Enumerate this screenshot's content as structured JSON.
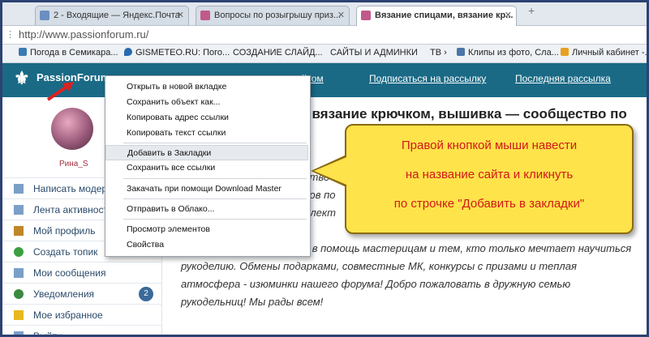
{
  "tabs": [
    {
      "title": "2 - Входящие — Яндекс.Почта",
      "color": "#6a8fc0"
    },
    {
      "title": "Вопросы по розыгрышу приз...",
      "color": "#c05a8a"
    },
    {
      "title": "Вязание спицами, вязание кр...",
      "color": "#c05a8a",
      "active": true
    }
  ],
  "address": {
    "url": "http://www.passionforum.ru/"
  },
  "bookmarks": [
    {
      "label": "Погода в Семикара...",
      "color": "#3a7ab0"
    },
    {
      "label": "GISMETEO.RU: Пого...",
      "color": "#2a6ab0"
    },
    {
      "label": "СОЗДАНИЕ СЛАЙД...",
      "color": "#eef1f5"
    },
    {
      "label": "САЙТЫ И АДМИНКИ",
      "color": "#eef1f5"
    },
    {
      "label": "ТВ",
      "color": "#eef1f5"
    },
    {
      "label": "Клипы из фото, Сла...",
      "color": "#4a76a8"
    },
    {
      "label": "Личный кабинет -...",
      "color": "#e8a020"
    }
  ],
  "site": {
    "logo": "PassionForum",
    "nav": [
      "Подписаться на рассылку",
      "Последняя рассылка"
    ],
    "nav_partial": "айтом",
    "heading": ", вязание крючком, вышивка — сообщество по"
  },
  "sidebar": {
    "username": "Рина_S",
    "items": [
      {
        "label": "Написать модер",
        "color": "#7aa0c8"
      },
      {
        "label": "Лента активност",
        "color": "#7aa0c8"
      },
      {
        "label": "Мой профиль",
        "color": "#c0862a"
      },
      {
        "label": "Создать топик",
        "color": "#3aa040"
      },
      {
        "label": "Мои сообщения",
        "color": "#7aa0c8"
      },
      {
        "label": "Уведомления",
        "color": "#3a8a40",
        "badge": "2"
      },
      {
        "label": "Мое избранное",
        "color": "#e8b820"
      },
      {
        "label": "Выйти",
        "color": "#7aa0c8"
      }
    ]
  },
  "content": {
    "frag1": "ство",
    "frag2": "сов по",
    "frag3": "ллект",
    "frag4": "ые",
    "lines": [
      "к в помощь мастерицам и тем, кто только мечтает научиться",
      "рукоделию. Обмены подарками, совместные МК, конкурсы с призами и теплая",
      "атмосфера - изюминки нашего форума! Добро пожаловать в дружную семью",
      "рукодельниц! Мы рады всем!"
    ]
  },
  "context_menu": [
    "Открыть в новой вкладке",
    "Сохранить объект как...",
    "Копировать адрес ссылки",
    "Копировать текст ссылки",
    "Добавить в Закладки",
    "Сохранить все ссылки",
    "Закачать при помощи Download Master",
    "Отправить в Облако...",
    "Просмотр элементов",
    "Свойства"
  ],
  "callout": {
    "lines": [
      "Правой кнопкой мыши навести",
      "на название сайта и кликнуть",
      "по строчке \"Добавить в закладки\""
    ]
  }
}
